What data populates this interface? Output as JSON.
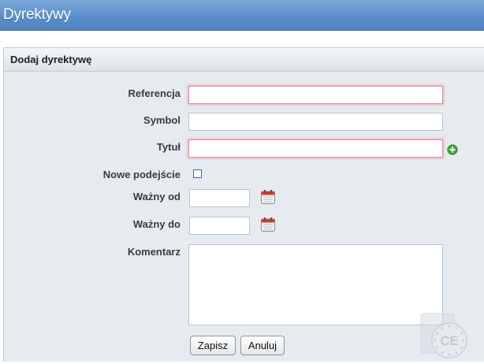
{
  "page": {
    "title": "Dyrektywy"
  },
  "panel": {
    "title": "Dodaj dyrektywę"
  },
  "form": {
    "referencja": {
      "label": "Referencja",
      "value": ""
    },
    "symbol": {
      "label": "Symbol",
      "value": ""
    },
    "tytul": {
      "label": "Tytuł",
      "value": ""
    },
    "nowe_podejscie": {
      "label": "Nowe podejście",
      "checked": false
    },
    "wazny_od": {
      "label": "Ważny od",
      "value": ""
    },
    "wazny_do": {
      "label": "Ważny do",
      "value": ""
    },
    "komentarz": {
      "label": "Komentarz",
      "value": ""
    }
  },
  "buttons": {
    "save": "Zapisz",
    "cancel": "Anuluj"
  },
  "watermark": {
    "text": "CE"
  },
  "icons": {
    "add": "plus-circle-icon",
    "calendar": "calendar-icon",
    "watermark": "ce-mark-icon"
  },
  "colors": {
    "header_blue": "#5c8fcb",
    "panel_bg": "#e6ebf0",
    "required_border": "#e58a98",
    "add_green": "#3aa83a"
  }
}
